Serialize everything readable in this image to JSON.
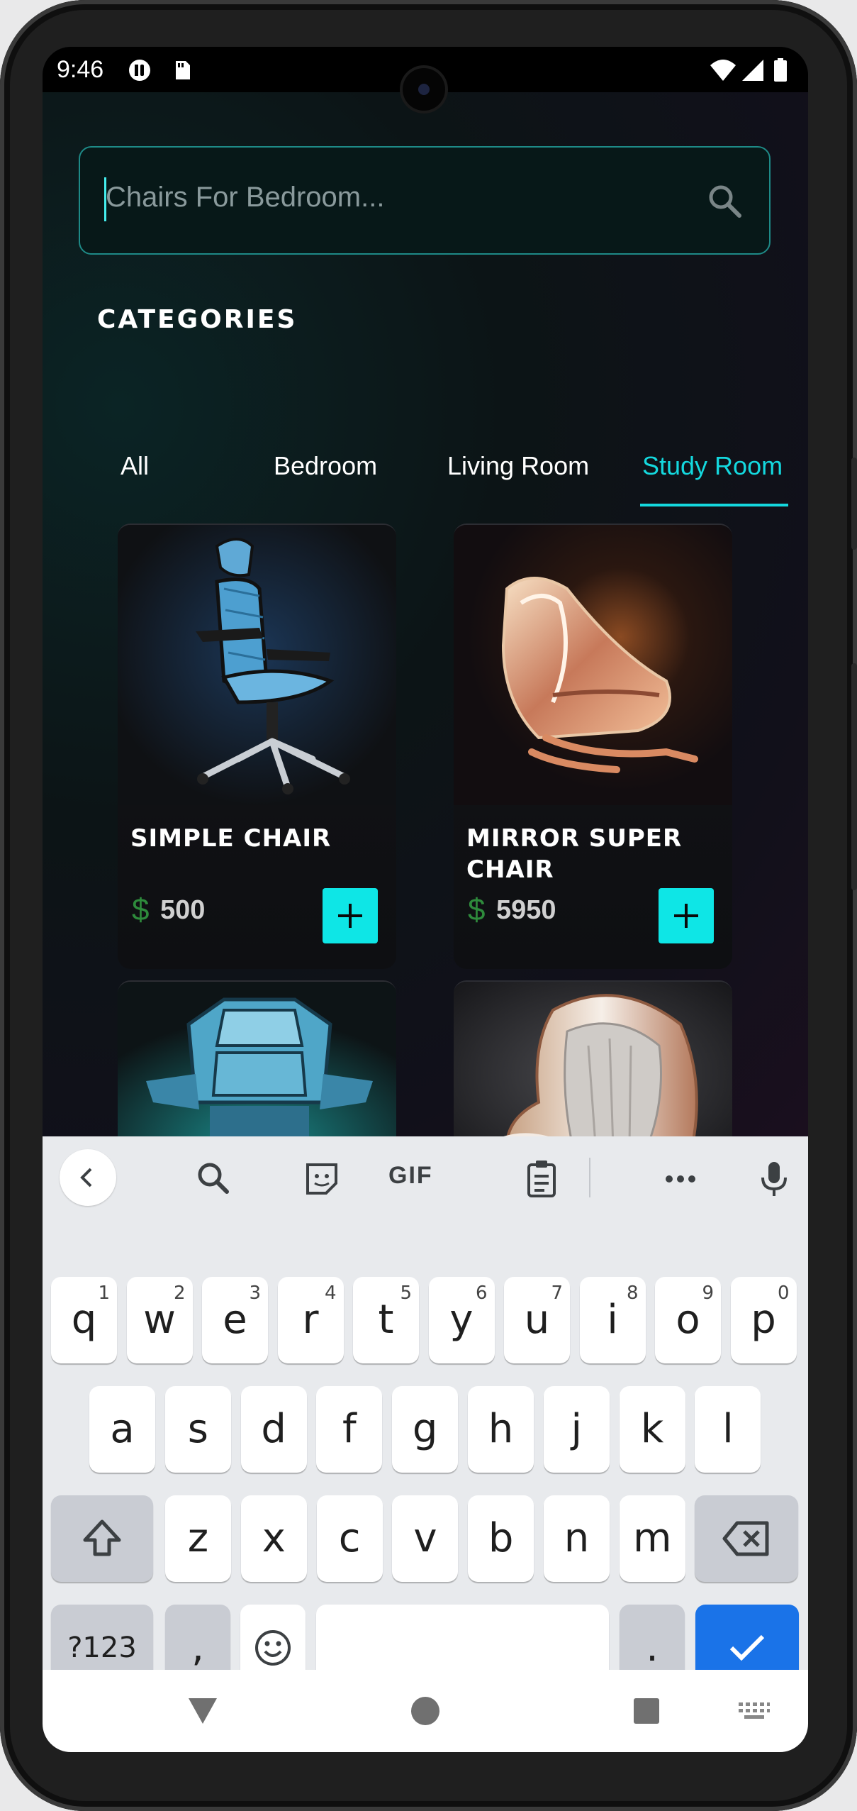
{
  "status_bar": {
    "time": "9:46"
  },
  "search": {
    "placeholder": "Chairs For Bedroom..."
  },
  "categories": {
    "title": "CATEGORIES",
    "tabs": [
      {
        "label": "All",
        "active": false
      },
      {
        "label": "Bedroom",
        "active": false
      },
      {
        "label": "Living Room",
        "active": false
      },
      {
        "label": "Study Room",
        "active": true
      }
    ]
  },
  "products": [
    {
      "name": "SIMPLE CHAIR",
      "currency": "$",
      "price": "500"
    },
    {
      "name": "MIRROR SUPER CHAIR",
      "currency": "$",
      "price": "5950"
    }
  ],
  "keyboard": {
    "toolbar": [
      "chevron-left-icon",
      "search-icon",
      "sticker-icon",
      "GIF",
      "clipboard-icon",
      "more-icon",
      "mic-icon"
    ],
    "row1": [
      {
        "k": "q",
        "n": "1"
      },
      {
        "k": "w",
        "n": "2"
      },
      {
        "k": "e",
        "n": "3"
      },
      {
        "k": "r",
        "n": "4"
      },
      {
        "k": "t",
        "n": "5"
      },
      {
        "k": "y",
        "n": "6"
      },
      {
        "k": "u",
        "n": "7"
      },
      {
        "k": "i",
        "n": "8"
      },
      {
        "k": "o",
        "n": "9"
      },
      {
        "k": "p",
        "n": "0"
      }
    ],
    "row2": [
      "a",
      "s",
      "d",
      "f",
      "g",
      "h",
      "j",
      "k",
      "l"
    ],
    "row3": [
      "z",
      "x",
      "c",
      "v",
      "b",
      "n",
      "m"
    ],
    "symbols_label": "?123",
    "comma": ",",
    "period": "."
  },
  "colors": {
    "accent": "#14d8de",
    "add_button": "#0ee6e6",
    "price_currency": "#2e8b3c",
    "keyboard_action": "#1a73e8"
  }
}
